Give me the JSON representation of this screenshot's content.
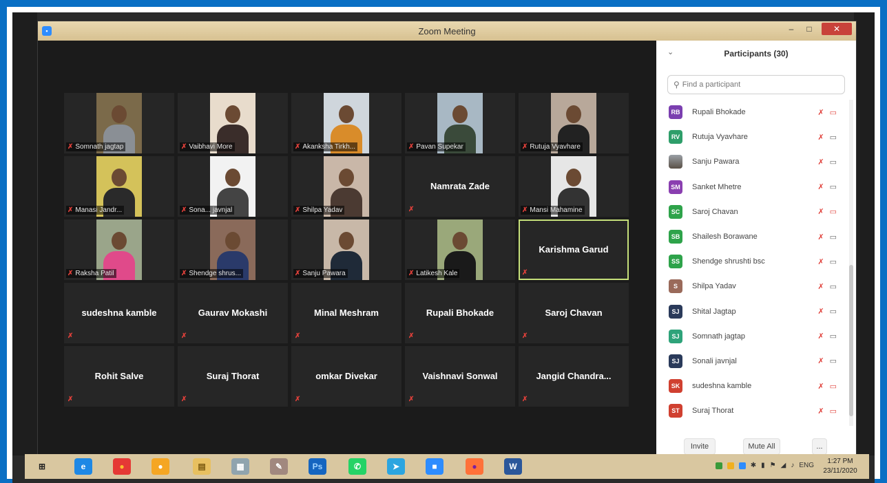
{
  "window": {
    "title": "Zoom Meeting",
    "minimize": "–",
    "maximize": "□",
    "close": "✕"
  },
  "tiles": [
    {
      "name": "Somnath jagtap",
      "video": true,
      "bg": "#7b6a4a",
      "shirt": "#8a8f95"
    },
    {
      "name": "Vaibhavi More",
      "video": true,
      "bg": "#e8dccc",
      "shirt": "#3a2d2a"
    },
    {
      "name": "Akanksha Tirkh...",
      "video": true,
      "bg": "#cfd6dc",
      "shirt": "#d98c2a"
    },
    {
      "name": "Pavan Supekar",
      "video": true,
      "bg": "#a8b8c4",
      "shirt": "#3a4a3a"
    },
    {
      "name": "Rutuja Vyavhare",
      "video": true,
      "bg": "#b8a89a",
      "shirt": "#222222"
    },
    {
      "name": "Manasi Jandr...",
      "video": true,
      "bg": "#d4c25a",
      "shirt": "#2a2a2a"
    },
    {
      "name": "Sona... javnjal",
      "video": true,
      "bg": "#f2f2f2",
      "shirt": "#444444"
    },
    {
      "name": "Shilpa Yadav",
      "video": true,
      "bg": "#c9b7a8",
      "shirt": "#4b3a32"
    },
    {
      "name": "Namrata Zade",
      "video": false
    },
    {
      "name": "Mansi Mahamine",
      "video": true,
      "bg": "#e6e6e6",
      "shirt": "#333333"
    },
    {
      "name": "Raksha Patil",
      "video": true,
      "bg": "#9aa58a",
      "shirt": "#e04a8a"
    },
    {
      "name": "Shendge shrus...",
      "video": true,
      "bg": "#8a6a5a",
      "shirt": "#2a3a6a"
    },
    {
      "name": "Sanju Pawara",
      "video": true,
      "bg": "#c8b8a8",
      "shirt": "#1f2a38"
    },
    {
      "name": "Latikesh Kale",
      "video": true,
      "bg": "#9aa87a",
      "shirt": "#1a1a1a"
    },
    {
      "name": "Karishma Garud",
      "video": false,
      "active": true
    },
    {
      "name": "sudeshna kamble",
      "video": false
    },
    {
      "name": "Gaurav Mokashi",
      "video": false
    },
    {
      "name": "Minal Meshram",
      "video": false
    },
    {
      "name": "Rupali Bhokade",
      "video": false
    },
    {
      "name": "Saroj Chavan",
      "video": false
    },
    {
      "name": "Rohit Salve",
      "video": false
    },
    {
      "name": "Suraj Thorat",
      "video": false
    },
    {
      "name": "omkar Divekar",
      "video": false
    },
    {
      "name": "Vaishnavi Sonwal",
      "video": false
    },
    {
      "name": "Jangid Chandra...",
      "video": false
    }
  ],
  "panel": {
    "title": "Participants (30)",
    "collapse": "⌄",
    "search_placeholder": "Find a participant",
    "participants": [
      {
        "initials": "RB",
        "name": "Rupali Bhokade",
        "color": "#7b3fb0",
        "video_off": true
      },
      {
        "initials": "RV",
        "name": "Rutuja Vyavhare",
        "color": "#2e9e6a",
        "video_off": false
      },
      {
        "initials": "",
        "name": "Sanju Pawara",
        "color": "#8a8a8a",
        "photo": true,
        "video_off": false
      },
      {
        "initials": "SM",
        "name": "Sanket Mhetre",
        "color": "#8a3fb0",
        "video_off": false
      },
      {
        "initials": "SC",
        "name": "Saroj Chavan",
        "color": "#2ea34a",
        "video_off": true
      },
      {
        "initials": "SB",
        "name": "Shailesh Borawane",
        "color": "#2ea34a",
        "video_off": false
      },
      {
        "initials": "SS",
        "name": "Shendge shrushti bsc",
        "color": "#2ea34a",
        "video_off": false
      },
      {
        "initials": "S",
        "name": "Shilpa Yadav",
        "color": "#9a6a5a",
        "video_off": false
      },
      {
        "initials": "SJ",
        "name": "Shital Jagtap",
        "color": "#2a3a5a",
        "video_off": false
      },
      {
        "initials": "SJ",
        "name": "Somnath jagtap",
        "color": "#2ea37a",
        "video_off": false
      },
      {
        "initials": "SJ",
        "name": "Sonali javnjal",
        "color": "#2a3a5a",
        "video_off": false
      },
      {
        "initials": "SK",
        "name": "sudeshna kamble",
        "color": "#d04030",
        "video_off": true
      },
      {
        "initials": "ST",
        "name": "Suraj Thorat",
        "color": "#d04030",
        "video_off": true
      },
      {
        "initials": "",
        "name": "",
        "color": "#e6a020",
        "video_off": false
      }
    ],
    "invite": "Invite",
    "mute_all": "Mute All",
    "more": "..."
  },
  "taskbar": {
    "apps": [
      {
        "name": "windows-start-icon",
        "glyph": "⊞",
        "color": "#d9c7a0",
        "fg": "#222"
      },
      {
        "name": "ie-icon",
        "glyph": "e",
        "color": "#1e88e5",
        "fg": "#fff"
      },
      {
        "name": "chrome-icon",
        "glyph": "●",
        "color": "#e53935",
        "fg": "#fbc02d"
      },
      {
        "name": "media-icon",
        "glyph": "●",
        "color": "#f5a623",
        "fg": "#fff"
      },
      {
        "name": "folder-icon",
        "glyph": "▤",
        "color": "#e8c060",
        "fg": "#7a5a10"
      },
      {
        "name": "calculator-icon",
        "glyph": "▦",
        "color": "#90a4ae",
        "fg": "#fff"
      },
      {
        "name": "paint-icon",
        "glyph": "✎",
        "color": "#a1887f",
        "fg": "#fff"
      },
      {
        "name": "photoshop-icon",
        "glyph": "Ps",
        "color": "#1565c0",
        "fg": "#9fd3ff"
      },
      {
        "name": "whatsapp-icon",
        "glyph": "✆",
        "color": "#25d366",
        "fg": "#fff"
      },
      {
        "name": "telegram-icon",
        "glyph": "➤",
        "color": "#2ca5e0",
        "fg": "#fff"
      },
      {
        "name": "zoom-icon",
        "glyph": "■",
        "color": "#2d8cff",
        "fg": "#fff"
      },
      {
        "name": "firefox-icon",
        "glyph": "●",
        "color": "#ff7139",
        "fg": "#7b1fa2"
      },
      {
        "name": "word-icon",
        "glyph": "W",
        "color": "#2b579a",
        "fg": "#fff"
      }
    ],
    "language": "ENG",
    "time": "1:27 PM",
    "date": "23/11/2020"
  }
}
